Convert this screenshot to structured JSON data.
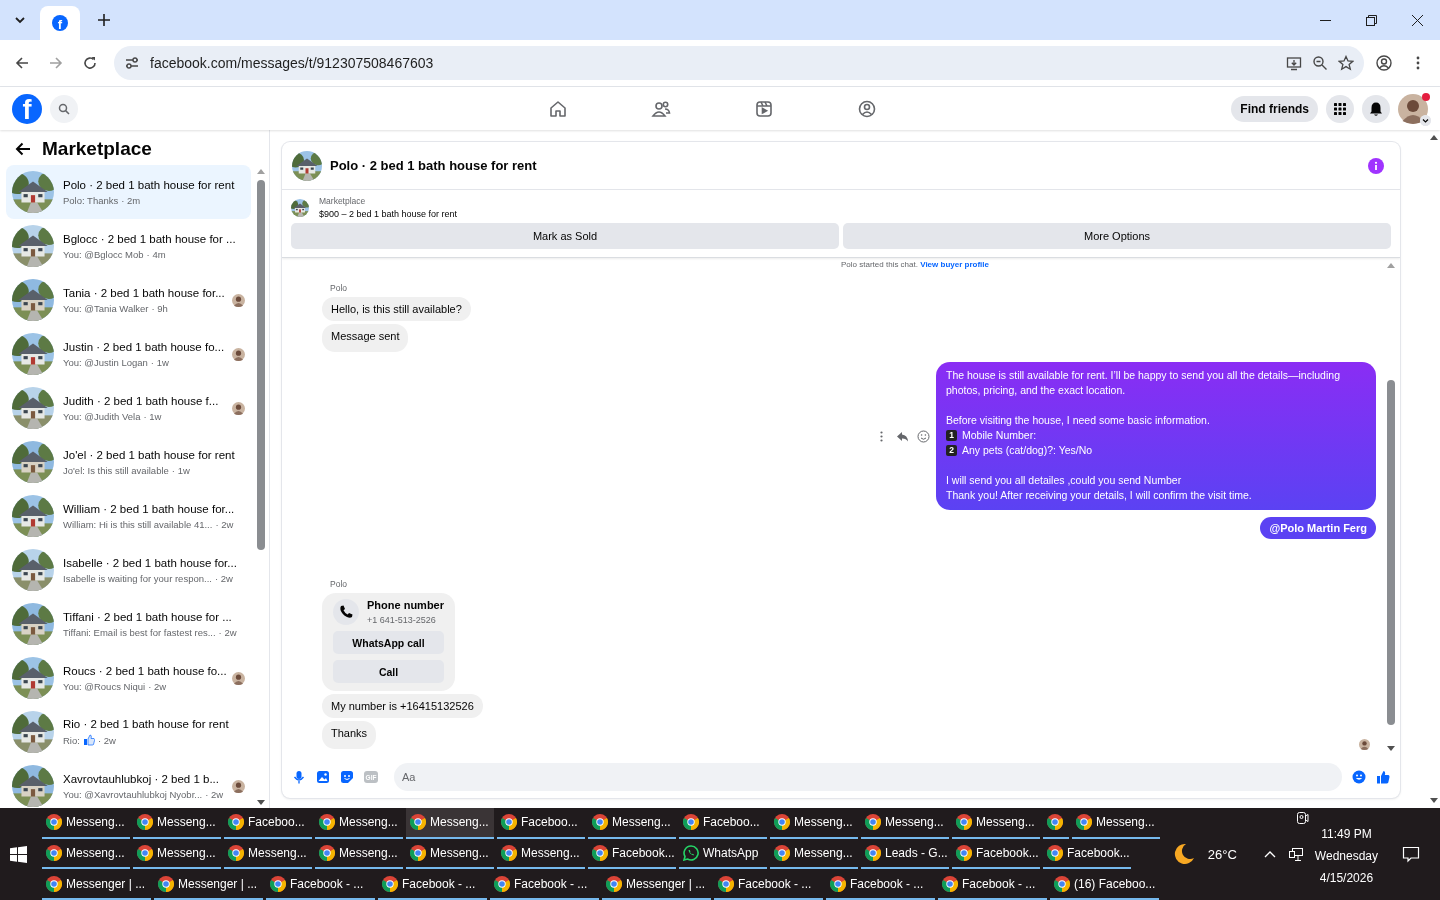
{
  "browser": {
    "tab_icon_letter": "f",
    "url": "facebook.com/messages/t/912307508467603"
  },
  "header": {
    "logo_letter": "f",
    "nav": [
      {
        "kind": "home"
      },
      {
        "kind": "friends"
      },
      {
        "kind": "video"
      },
      {
        "kind": "gaming"
      }
    ],
    "find_friends": "Find friends"
  },
  "sidebar": {
    "title": "Marketplace",
    "conversations": [
      {
        "title": "Polo · 2 bed 1 bath house for rent",
        "preview": "Polo: Thanks",
        "time": "· 2m",
        "selected": true,
        "seen": false
      },
      {
        "title": "Bglocc · 2 bed 1 bath house for ...",
        "preview": "You: @Bglocc Mob",
        "time": "· 4m",
        "selected": false,
        "seen": false
      },
      {
        "title": "Tania · 2 bed 1 bath house for...",
        "preview": "You: @Tania Walker",
        "time": "· 9h",
        "selected": false,
        "seen": true
      },
      {
        "title": "Justin · 2 bed 1 bath house fo...",
        "preview": "You: @Justin Logan",
        "time": "· 1w",
        "selected": false,
        "seen": true
      },
      {
        "title": "Judith · 2 bed 1 bath house f...",
        "preview": "You: @Judith Vela",
        "time": "· 1w",
        "selected": false,
        "seen": true
      },
      {
        "title": "Jo'el · 2 bed 1 bath house for rent",
        "preview": "Jo'el: Is this still available",
        "time": "· 1w",
        "selected": false,
        "seen": false
      },
      {
        "title": "William · 2 bed 1 bath house for...",
        "preview": "William: Hi is this still available 41...",
        "time": "· 2w",
        "selected": false,
        "seen": false
      },
      {
        "title": "Isabelle · 2 bed 1 bath house for...",
        "preview": "Isabelle is waiting for your respon...",
        "time": "· 2w",
        "selected": false,
        "seen": false
      },
      {
        "title": "Tiffani · 2 bed 1 bath house for ...",
        "preview": "Tiffani: Email is best for fastest res...",
        "time": "· 2w",
        "selected": false,
        "seen": false
      },
      {
        "title": "Roucs · 2 bed 1 bath house fo...",
        "preview": "You: @Roucs Niqui",
        "time": "· 2w",
        "selected": false,
        "seen": true
      },
      {
        "title": "Rio · 2 bed 1 bath house for rent",
        "preview": "Rio:",
        "liked": true,
        "time": "· 2w",
        "selected": false,
        "seen": false
      },
      {
        "title": "Xavrovtauhlubkoj · 2 bed 1 b...",
        "preview": "You: @Xavrovtauhlubkoj Nyobr...",
        "time": "· 2w",
        "selected": false,
        "seen": true
      }
    ]
  },
  "chat": {
    "title": "Polo · 2 bed 1 bath house for rent",
    "listing": {
      "label": "Marketplace",
      "title": "$900 – 2 bed 1 bath house for rent"
    },
    "actions": [
      "Mark as Sold",
      "More Options"
    ],
    "messages": [
      {
        "kind": "notice",
        "text": "Polo started this chat.",
        "link": "View buyer profile"
      },
      {
        "kind": "incoming",
        "sender": "Polo",
        "items": [
          {
            "kind": "text",
            "text": "Hello, is this still available?"
          },
          {
            "kind": "text",
            "text": "Message sent"
          }
        ]
      },
      {
        "kind": "outgoing",
        "paragraphs": [
          [
            {
              "text": "The house is still available for rent. I’ll be happy to send you all the details—including photos, pricing, and the exact location."
            }
          ],
          [
            {
              "text": "Before visiting the house, I need some basic information."
            },
            {
              "badge": "1",
              "text": "Mobile Number:"
            },
            {
              "badge": "2",
              "text": "Any pets (cat/dog)?: Yes/No"
            }
          ],
          [
            {
              "text": "I will send you all detailes ,could you send Number"
            },
            {
              "text": "Thank you! After receiving your details, I will confirm the visit time."
            }
          ]
        ],
        "mention": "@Polo Martin Ferg"
      },
      {
        "kind": "incoming",
        "sender": "Polo",
        "items": [
          {
            "kind": "contact",
            "title": "Phone number",
            "number": "+1 641-513-2526",
            "buttons": [
              "WhatsApp call",
              "Call"
            ]
          },
          {
            "kind": "text",
            "text": "My number is +16415132526"
          },
          {
            "kind": "text",
            "text": "Thanks"
          }
        ]
      }
    ],
    "seen": true,
    "composer": {
      "placeholder": "Aa",
      "gif_label": "GIF"
    }
  },
  "taskbar": {
    "rows": [
      {
        "items": [
          {
            "kind": "chrome",
            "label": "Messeng...",
            "selected": false
          },
          {
            "kind": "chrome",
            "label": "Messeng...",
            "selected": false
          },
          {
            "kind": "chrome",
            "label": "Faceboo...",
            "selected": false
          },
          {
            "kind": "chrome",
            "label": "Messeng...",
            "selected": false
          },
          {
            "kind": "chrome",
            "label": "Messeng...",
            "selected": true
          },
          {
            "kind": "chrome",
            "label": "Faceboo...",
            "selected": false
          },
          {
            "kind": "chrome",
            "label": "Messeng...",
            "selected": false
          },
          {
            "kind": "chrome",
            "label": "Faceboo...",
            "selected": false
          },
          {
            "kind": "chrome",
            "label": "Messeng...",
            "selected": false
          },
          {
            "kind": "chrome",
            "label": "Messeng...",
            "selected": false
          },
          {
            "kind": "chrome",
            "label": "Messeng...",
            "selected": false
          },
          {
            "kind": "chrome",
            "selected": false
          },
          {
            "kind": "chrome",
            "label": "Messeng...",
            "selected": false
          }
        ]
      },
      {
        "items": [
          {
            "kind": "chrome",
            "label": "Messeng...",
            "selected": false
          },
          {
            "kind": "chrome",
            "label": "Messeng...",
            "selected": false
          },
          {
            "kind": "chrome",
            "label": "Messeng...",
            "selected": false
          },
          {
            "kind": "chrome",
            "label": "Messeng...",
            "selected": false
          },
          {
            "kind": "chrome",
            "label": "Messeng...",
            "selected": false
          },
          {
            "kind": "chrome",
            "label": "Messeng...",
            "selected": false
          },
          {
            "kind": "chrome",
            "label": "Facebook...",
            "selected": false
          },
          {
            "kind": "whatsapp",
            "label": "WhatsApp",
            "selected": false
          },
          {
            "kind": "chrome",
            "label": "Messeng...",
            "selected": false
          },
          {
            "kind": "chrome",
            "label": "Leads - G...",
            "selected": false
          },
          {
            "kind": "chrome",
            "label": "Facebook...",
            "selected": false
          },
          {
            "kind": "chrome",
            "label": "Facebook...",
            "selected": false
          }
        ]
      },
      {
        "items": [
          {
            "kind": "chrome",
            "label": "Messenger | ...",
            "selected": false
          },
          {
            "kind": "chrome",
            "label": "Messenger | ...",
            "selected": false
          },
          {
            "kind": "chrome",
            "label": "Facebook - ...",
            "selected": false
          },
          {
            "kind": "chrome",
            "label": "Facebook - ...",
            "selected": false
          },
          {
            "kind": "chrome",
            "label": "Facebook - ...",
            "selected": false
          },
          {
            "kind": "chrome",
            "label": "Messenger | ...",
            "selected": false
          },
          {
            "kind": "chrome",
            "label": "Facebook - ...",
            "selected": false
          },
          {
            "kind": "chrome",
            "label": "Facebook - ...",
            "selected": false
          },
          {
            "kind": "chrome",
            "label": "Facebook - ...",
            "selected": false
          },
          {
            "kind": "chrome",
            "label": "(16) Faceboo...",
            "selected": false
          }
        ]
      }
    ],
    "tray": {
      "temperature": "26°C",
      "time": "11:49 PM",
      "day": "Wednesday",
      "date": "4/15/2026"
    }
  }
}
